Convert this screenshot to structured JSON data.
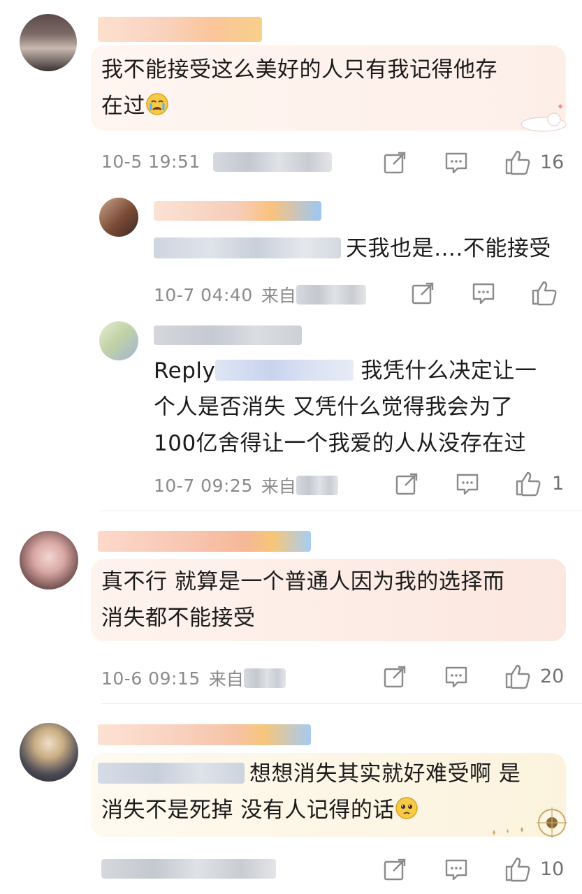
{
  "comments": [
    {
      "text_line1": "我不能接受这么美好的人只有我记得他存",
      "text_line2": "在过",
      "emoji": "crying-face",
      "time": "10-5 19:51",
      "likes": "16"
    },
    {
      "text": "天我也是….不能接受",
      "time": "10-7 04:40",
      "source_prefix": "来自",
      "likes": ""
    },
    {
      "reply_prefix": "Reply",
      "text_line1": "我凭什么决定让一",
      "text_line2": "个人是否消失 又凭什么觉得我会为了",
      "text_line3": "100亿舍得让一个我爱的人从没存在过",
      "time": "10-7 09:25",
      "source_prefix": "来自",
      "likes": "1"
    },
    {
      "text_line1": "真不行 就算是一个普通人因为我的选择而",
      "text_line2": "消失都不能接受",
      "time": "10-6 09:15",
      "source_prefix": "来自",
      "likes": "20"
    },
    {
      "text_line1": "想想消失其实就好难受啊 是",
      "text_line2": "消失不是死掉 没有人记得的话",
      "emoji": "pleading-face",
      "likes": "10"
    }
  ],
  "icons": {
    "forward": "share-icon",
    "comment": "comment-icon",
    "like": "thumbs-up-icon"
  },
  "colors": {
    "text": "#1b1b1b",
    "meta": "#8a8a8a",
    "bubble_pink": "#fdf0ea",
    "bubble_cream": "#fbf6e6",
    "icon": "#8a8a8a"
  }
}
